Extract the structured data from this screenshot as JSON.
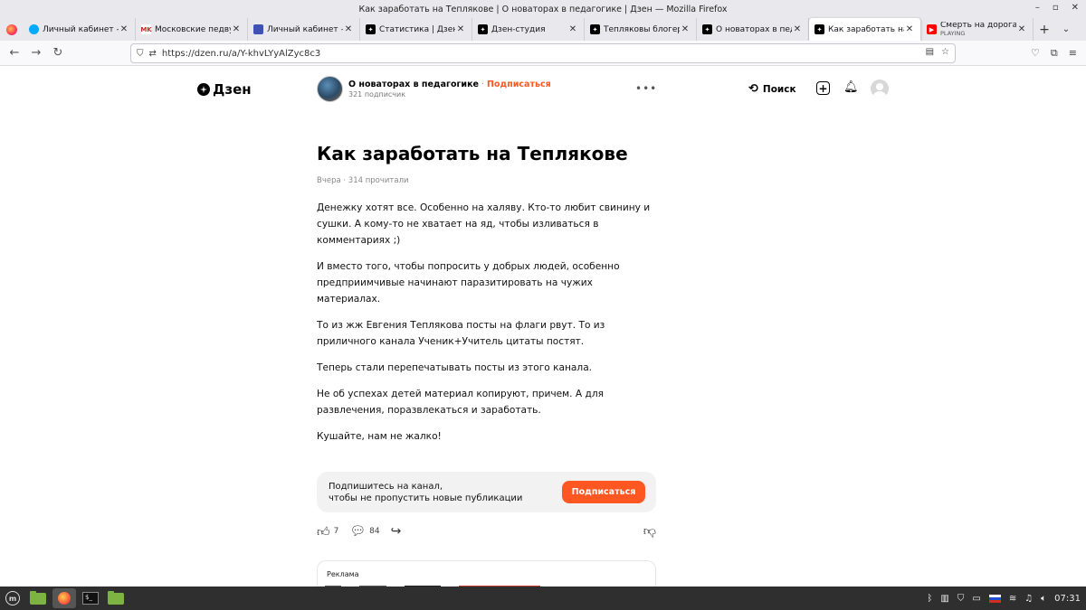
{
  "window": {
    "title": "Как заработать на Теплякове | О новаторах в педагогике | Дзен — Mozilla Firefox",
    "controls": [
      "–",
      "▫",
      "✕"
    ]
  },
  "tabs": [
    {
      "label": "Личный кабинет - Авито",
      "favicon": "avito-icon",
      "favicon_color": "#00aaff"
    },
    {
      "label": "Московские педвузы с",
      "favicon": "mk-icon",
      "favicon_color": "#c62828"
    },
    {
      "label": "Личный кабинет — Пуш",
      "favicon": "push-icon",
      "favicon_color": "#3f51b5"
    },
    {
      "label": "Статистика | Дзен",
      "favicon": "zen-icon",
      "favicon_color": "#000000"
    },
    {
      "label": "Дзен-студия",
      "favicon": "zen-icon",
      "favicon_color": "#000000"
    },
    {
      "label": "Тепляковы блогеры | О",
      "favicon": "zen-icon",
      "favicon_color": "#000000"
    },
    {
      "label": "О новаторах в педагоги",
      "favicon": "zen-icon",
      "favicon_color": "#000000"
    },
    {
      "label": "Как заработать на Тепл",
      "favicon": "zen-icon",
      "favicon_color": "#000000",
      "active": true
    },
    {
      "label": "Смерть на дорогах — Ш",
      "sublabel": "PLAYING",
      "favicon": "youtube-icon",
      "favicon_color": "#ff0000"
    }
  ],
  "tab_close": "✕",
  "tab_new": "+",
  "tab_list": "⌄",
  "navbar": {
    "url": "https://dzen.ru/a/Y-khvLYyAlZyc8c3"
  },
  "header": {
    "logo_text": "Дзен",
    "channel_name": "О новаторах в педагогике",
    "channel_sep": " · ",
    "channel_subscribe": "Подписаться",
    "channel_subs": "321 подписчик",
    "more": "•••",
    "search_label": "Поиск"
  },
  "article": {
    "title": "Как заработать на Теплякове",
    "meta": "Вчера · 314 прочитали",
    "paragraphs": [
      "Денежку хотят все. Особенно на халяву. Кто-то любит свинину и сушки. А кому-то не хватает на яд, чтобы изливаться в комментариях ;)",
      "И вместо того, чтобы попросить у добрых людей, особенно предприимчивые начинают паразитировать на чужих материалах.",
      "То из жж Евгения Теплякова посты на флаги рвут. То из приличного канала Ученик+Учитель цитаты постят.",
      "Теперь стали перепечатывать посты из этого канала.",
      "Не об успехах детей материал копируют, причем. А для развлечения, поразвлекаться и заработать.",
      "Кушайте, нам не жалко!"
    ]
  },
  "subscribe_banner": {
    "line1": "Подпишитесь на канал,",
    "line2": "чтобы не пропустить новые публикации",
    "button": "Подписаться",
    "accent": "#ff5722"
  },
  "reactions": {
    "likes": "7",
    "comments": "84"
  },
  "ad": {
    "label": "Реклама"
  },
  "taskbar": {
    "terminal_glyph": "$_",
    "clock": "07:31"
  }
}
